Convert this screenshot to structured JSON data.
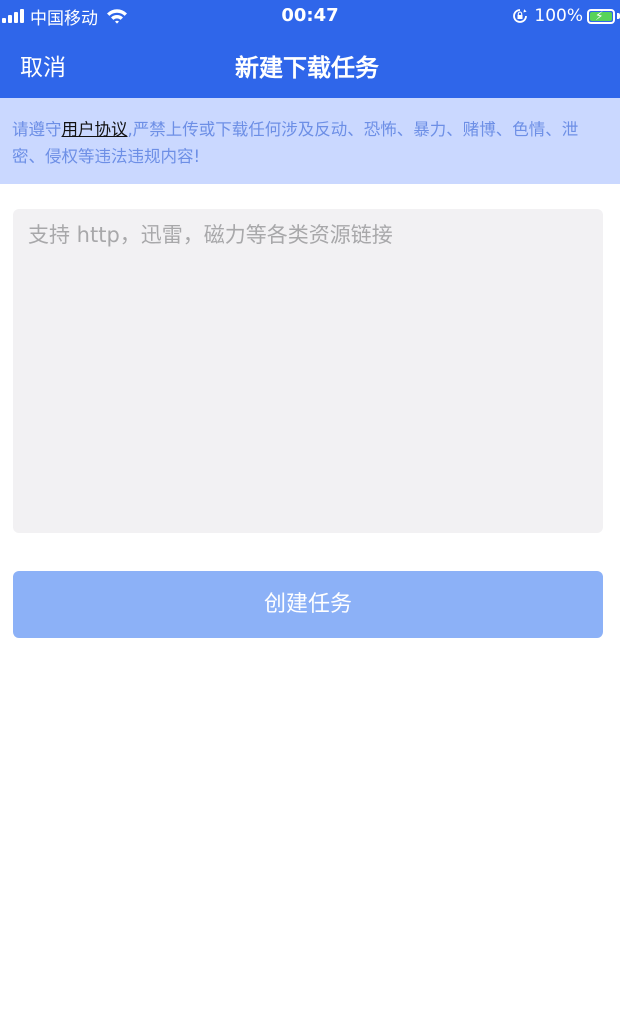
{
  "status_bar": {
    "carrier": "中国移动",
    "time": "00:47",
    "battery_percent": "100%",
    "battery_level": 1.0,
    "signal_bars": 4,
    "wifi_icon": "wifi-icon",
    "rotation_lock_icon": "rotation-lock-icon",
    "battery_color": "#58d35a"
  },
  "nav": {
    "cancel_label": "取消",
    "title": "新建下载任务",
    "background_color": "#2f66ea"
  },
  "notice": {
    "prefix": "请遵守",
    "link": "用户协议",
    "suffix": ",严禁上传或下载任何涉及反动、恐怖、暴力、赌博、色情、泄密、侵权等违法违规内容!",
    "background_color": "#cad8ff",
    "text_color": "#6d8fe6"
  },
  "input": {
    "value": "",
    "placeholder": "支持 http，迅雷，磁力等各类资源链接"
  },
  "create_button": {
    "label": "创建任务",
    "color": "#8cb1f7"
  }
}
